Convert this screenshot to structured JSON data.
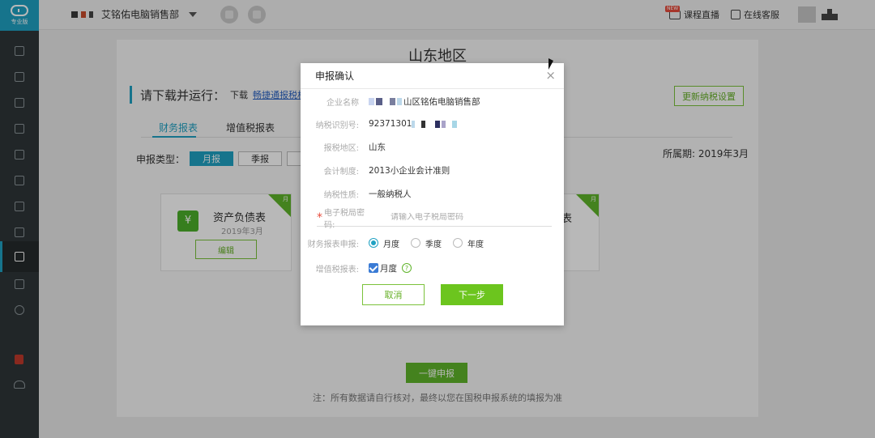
{
  "sidebar": {
    "logo_text": "专业版",
    "icons": [
      "ledger-icon",
      "voucher-icon",
      "chart-icon",
      "book-icon",
      "report-icon",
      "document-icon",
      "gift-icon",
      "invoice-icon",
      "tax-declare-icon",
      "settings-doc-icon",
      "gear-icon"
    ]
  },
  "header": {
    "company_name": "艾铭佑电脑销售部",
    "live_tag": "NEW",
    "live_course": "课程直播",
    "online_service": "在线客服"
  },
  "background": {
    "region_title": "山东地区",
    "download_prefix": "请下载并运行：",
    "download_word": "下载",
    "download_link": "畅捷通报税机器",
    "update_button": "更新纳税设置",
    "tabs": [
      "财务报表",
      "增值税报表"
    ],
    "period_type_label": "申报类型：",
    "period_monthly": "月报",
    "period_quarterly": "季报",
    "period_label": "所属期: 2019年3月",
    "card_balance_title": "资产负债表",
    "card_balance_sub": "2019年3月",
    "card_balance_button": "编辑",
    "card_corner": "月",
    "card_right_title": "表",
    "submit_all": "一键申报",
    "footnote": "注：所有数据请自行核对，最终以您在国税申报系统的填报为准"
  },
  "modal": {
    "title": "申报确认",
    "close": "×",
    "company_label": "企业名称",
    "company_value": "山区铭佑电脑销售部",
    "tax_id_label": "纳税识别号:",
    "tax_id_value": "92371301",
    "region_label": "报税地区:",
    "region_value": "山东",
    "accounting_label": "会计制度:",
    "accounting_value": "2013小企业会计准则",
    "taxpayer_label": "纳税性质:",
    "taxpayer_value": "一般纳税人",
    "password_label": "电子税局密码:",
    "password_placeholder": "请输入电子税局密码",
    "financial_label": "财务报表申报:",
    "financial_options": [
      "月度",
      "季度",
      "年度"
    ],
    "vat_label": "增值税报表:",
    "vat_option": "月度",
    "help": "?",
    "cancel": "取消",
    "next": "下一步"
  },
  "colors": {
    "accent": "#1fa1c2",
    "green": "#6cc51e",
    "sidebar_bg": "#2f3538"
  }
}
